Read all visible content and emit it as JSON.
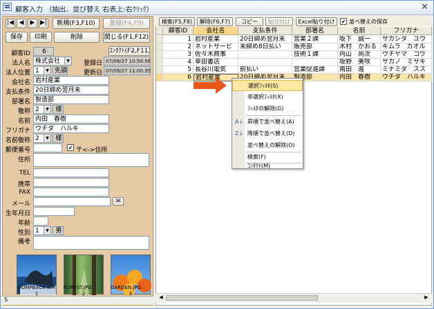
{
  "window": {
    "title": "顧客入力 （抽出、並び替え 右表上:右ｸﾘｯｸ）",
    "close": "✕"
  },
  "nav": {
    "first": "|◀",
    "prev": "◀",
    "next": "▶",
    "last": "▶|"
  },
  "buttons": {
    "new": "新規(F3,F10)",
    "register": "登録(F4,F9)",
    "save": "保存",
    "print": "印刷",
    "delete": "削除",
    "close": "閉じる(F1,F12)",
    "contact": "ｺﾝﾀｸﾄ(F2,F11)"
  },
  "form": {
    "customer_id_label": "顧客ID",
    "customer_id": "6",
    "corp_name_label": "法人名",
    "corp_name": "株式会社",
    "corp_pos_label": "法人位置",
    "corp_pos": "1",
    "corp_pos_text": "先頭",
    "reg_date_label": "登録日",
    "reg_date": "07/09/27 10:50:56",
    "upd_date_label": "更新日",
    "upd_date": "07/09/27 11:00:35",
    "company_label": "会社名",
    "company": "岩村産業",
    "payment_label": "支払条件",
    "payment": "20日締め翌月末",
    "dept_label": "部署名",
    "dept": "製造部",
    "honorific_label": "敬称",
    "honorific": "2",
    "honorific_text": "様",
    "name_label": "名前",
    "name": "内田　春樹",
    "furigana_label": "フリガナ",
    "furigana": "ウチダ　ハルキ",
    "name_hon_label": "名前敬称",
    "name_hon": "2",
    "name_hon_text": "様",
    "zip_label": "郵便番号",
    "zip_addr_check": "〒<->住所",
    "address_label": "住所",
    "tel_label": "TEL",
    "mobile_label": "携帯",
    "fax_label": "FAX",
    "mail_label": "メール",
    "birth_label": "生年月日",
    "age_label": "年齢",
    "gender_label": "性別",
    "gender": "1",
    "gender_text": "男",
    "notes_label": "備考"
  },
  "images": [
    {
      "caption": "HUMPBACK WH",
      "num": "1"
    },
    {
      "caption": "FOREST.JPG",
      "num": "2"
    },
    {
      "caption": "GARDEN.JPG",
      "num": "3"
    }
  ],
  "left_footer": "S",
  "toolbar": {
    "search": "検索(F5,F8)",
    "clear": "解除(F6,F7)",
    "copy": "コピー",
    "paste": "貼り付け",
    "excel_paste": "Excel貼り付け",
    "save_sort": "並べ替えの保存"
  },
  "grid": {
    "headers": [
      "顧客ID",
      "会社名",
      "支払条件",
      "部署名",
      "名前",
      "フリガナ"
    ],
    "rows": [
      [
        "1",
        "岩村産業",
        "20日締め翌月末",
        "営業２課",
        "坂下　誠一",
        "サカシタ　ユウ"
      ],
      [
        "2",
        "ネットサービ",
        "末締め8日払い",
        "販売部",
        "木村　かおる",
        "キムラ　カオル"
      ],
      [
        "3",
        "佐々木商事",
        "",
        "技術１課",
        "内山　尚次",
        "ウチヤマ　コウ"
      ],
      [
        "4",
        "幸田書店",
        "",
        "",
        "坂野　美咲",
        "サカノ　ミサキ"
      ],
      [
        "5",
        "長谷川電気",
        "前払い",
        "営業促進課",
        "南田　進",
        "ミナミダ　スス"
      ],
      [
        "6",
        "岩村産業",
        "20日締め翌月末",
        "製造部",
        "内田　春樹",
        "ウチダ　ハルキ"
      ]
    ]
  },
  "context_menu": [
    {
      "icon": "",
      "label": "選択ﾌｨﾙﾀ(S)",
      "highlight": true
    },
    {
      "icon": "",
      "label": "非選択ﾌｨﾙﾀ(X)"
    },
    {
      "icon": "",
      "label": "ﾌｨﾙﾀの解除(G)"
    },
    {
      "icon": "A↓",
      "label": "昇順で並べ替え(A)"
    },
    {
      "icon": "Z↓",
      "label": "降順で並べ替え(D)"
    },
    {
      "icon": "",
      "label": "並べ替えの解除(O)"
    },
    {
      "icon": "",
      "label": "検索(F)"
    },
    {
      "icon": "",
      "label": "ｺﾝﾀｸﾄ(M)"
    }
  ],
  "colors": {
    "accent_arrow": "#e8561c",
    "left_panel": "#e5c9a4",
    "menu_highlight": "#ffe8a6"
  }
}
